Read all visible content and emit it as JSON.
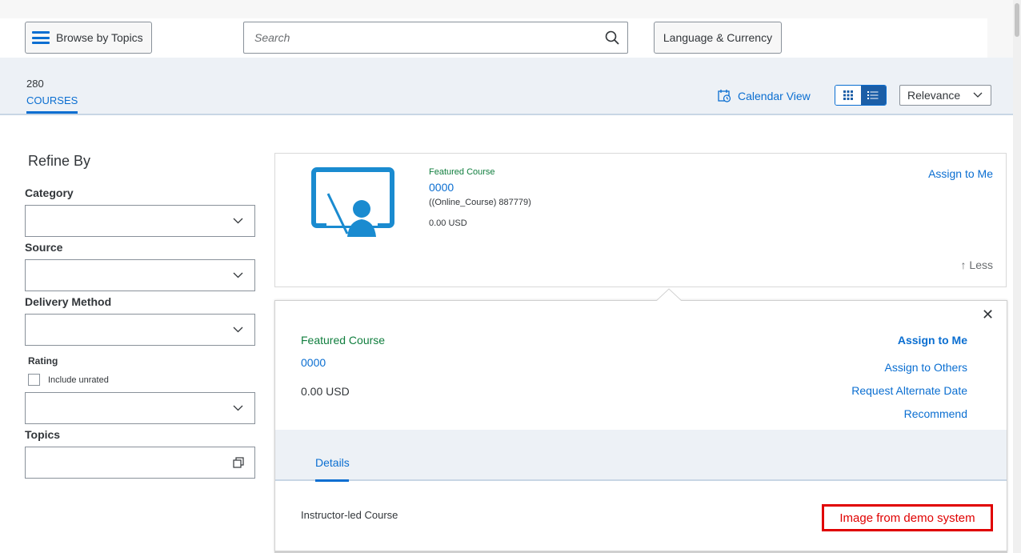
{
  "topbar": {
    "browse_label": "Browse by Topics",
    "search_placeholder": "Search",
    "language_label": "Language & Currency"
  },
  "results": {
    "count": "280",
    "count_label": "COURSES",
    "calendar_view": "Calendar View",
    "sort_value": "Relevance"
  },
  "filters": {
    "title": "Refine By",
    "category": "Category",
    "source": "Source",
    "delivery_method": "Delivery Method",
    "rating": "Rating",
    "include_unrated": "Include unrated",
    "topics": "Topics"
  },
  "course": {
    "featured": "Featured Course",
    "title": "0000",
    "subtitle": "((Online_Course) 887779)",
    "price": "0.00 USD",
    "assign": "Assign to Me",
    "less": "↑ Less"
  },
  "details_panel": {
    "close": "✕",
    "featured": "Featured Course",
    "title": "0000",
    "price": "0.00 USD",
    "actions": [
      "Assign to Me",
      "Assign to Others",
      "Request Alternate Date",
      "Recommend"
    ],
    "tab": "Details",
    "delivery": "Instructor-led Course",
    "annotation": "Image from demo system"
  },
  "colors": {
    "accent": "#0a6ed1",
    "featured": "#107e3e",
    "annotation": "#e00000"
  }
}
